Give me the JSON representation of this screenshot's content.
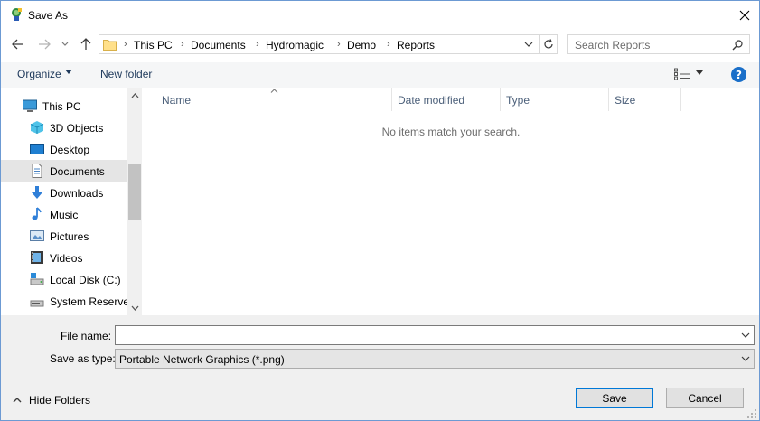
{
  "window": {
    "title": "Save As"
  },
  "address": {
    "crumbs": [
      "This PC",
      "Documents",
      "Hydromagic",
      "Demo",
      "Reports"
    ]
  },
  "search": {
    "placeholder": "Search Reports"
  },
  "toolbar": {
    "organize": "Organize",
    "new_folder": "New folder",
    "help": "?"
  },
  "nav": {
    "items": [
      {
        "label": "This PC",
        "icon": "computer-icon"
      },
      {
        "label": "3D Objects",
        "icon": "cube-icon"
      },
      {
        "label": "Desktop",
        "icon": "desktop-icon"
      },
      {
        "label": "Documents",
        "icon": "document-icon",
        "selected": true
      },
      {
        "label": "Downloads",
        "icon": "download-arrow-icon"
      },
      {
        "label": "Music",
        "icon": "music-note-icon"
      },
      {
        "label": "Pictures",
        "icon": "picture-icon"
      },
      {
        "label": "Videos",
        "icon": "film-icon"
      },
      {
        "label": "Local Disk (C:)",
        "icon": "drive-icon"
      },
      {
        "label": "System Reserved",
        "icon": "drive-icon"
      }
    ]
  },
  "columns": [
    "Name",
    "Date modified",
    "Type",
    "Size"
  ],
  "content": {
    "empty_message": "No items match your search."
  },
  "form": {
    "file_name_label": "File name:",
    "file_name_value": "",
    "save_type_label": "Save as type:",
    "save_type_value": "Portable Network Graphics (*.png)"
  },
  "footer": {
    "hide_folders": "Hide Folders",
    "save": "Save",
    "cancel": "Cancel"
  },
  "colors": {
    "accent": "#0078d7",
    "help": "#1a6fc9",
    "selected_bg": "#e5e5e5"
  }
}
